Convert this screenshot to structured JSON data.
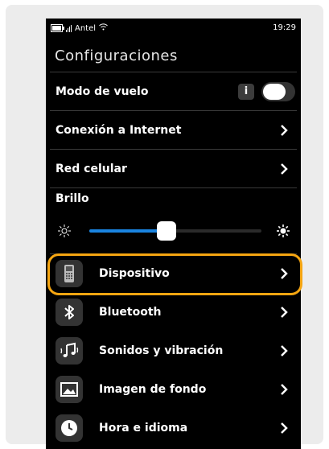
{
  "status_bar": {
    "carrier": "Antel",
    "time": "19:29"
  },
  "screen_title": "Configuraciones",
  "rows": {
    "airplane": {
      "label": "Modo de vuelo",
      "info_glyph": "i",
      "toggle_on": false
    },
    "internet": {
      "label": "Conexión a Internet"
    },
    "cellular": {
      "label": "Red celular"
    }
  },
  "brightness": {
    "label": "Brillo",
    "level": 0.45
  },
  "apps": [
    {
      "label": "Dispositivo",
      "icon": "device-phone-icon"
    },
    {
      "label": "Bluetooth",
      "icon": "bluetooth-icon"
    },
    {
      "label": "Sonidos y vibración",
      "icon": "music-note-icon"
    },
    {
      "label": "Imagen de fondo",
      "icon": "image-icon"
    },
    {
      "label": "Hora e idioma",
      "icon": "clock-icon"
    }
  ],
  "colors": {
    "accent": "#1a84e0",
    "highlight": "#f5a511",
    "background": "#000000"
  }
}
